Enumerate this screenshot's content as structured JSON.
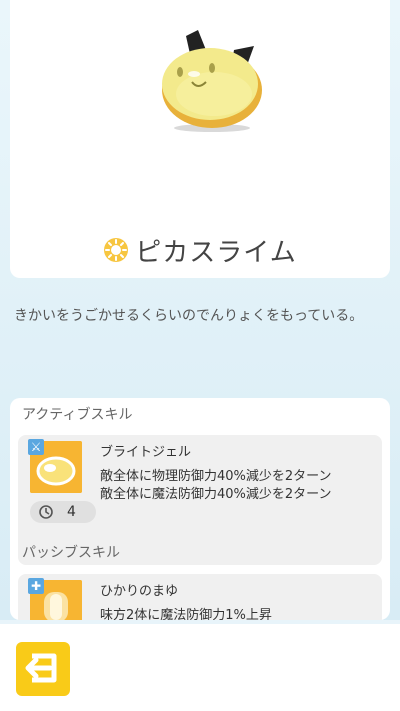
{
  "monster": {
    "name": "ピカスライム",
    "description": "きかいをうごかせるくらいのでんりょくをもっている。",
    "element_icon": "sun-element-icon"
  },
  "skills": {
    "active_title": "アクティブスキル",
    "active": {
      "name": "ブライトジェル",
      "effects": [
        "敵全体に物理防御力40%減少を2ターン",
        "敵全体に魔法防御力40%減少を2ターン"
      ],
      "cooldown": "4",
      "badge_icon": "sword-icon"
    },
    "passive_title": "パッシブスキル",
    "passive": {
      "name": "ひかりのまゆ",
      "effect_partial": "味方2体に魔法防御力1%上昇",
      "badge_icon": "plus-icon"
    }
  },
  "nav": {
    "back_icon": "back-arrow-icon"
  },
  "colors": {
    "accent_yellow": "#f9cb18",
    "skill_orange": "#f7b532",
    "background": "#e8f4fa"
  }
}
